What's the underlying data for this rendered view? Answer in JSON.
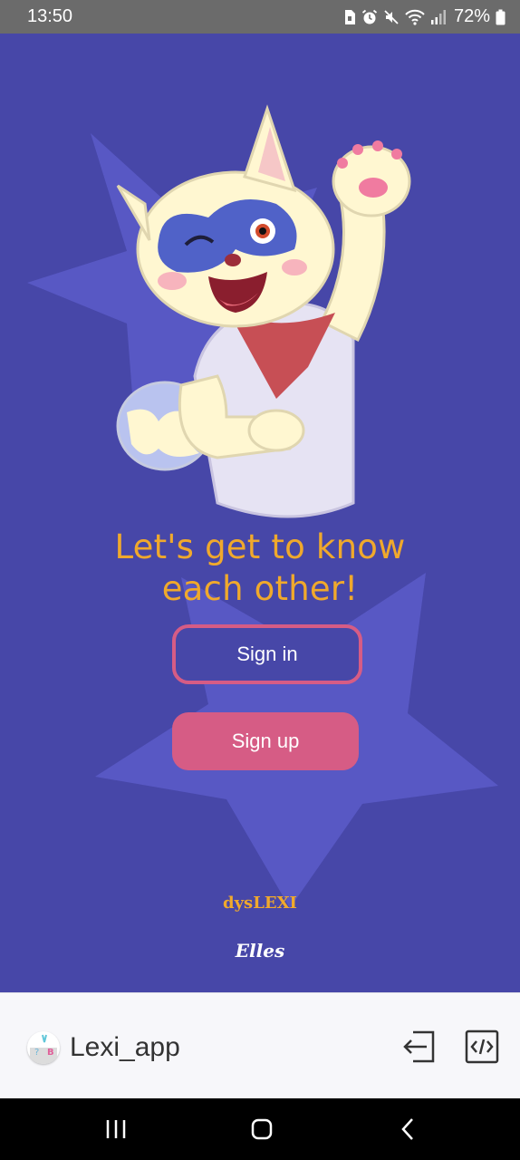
{
  "status_bar": {
    "time": "13:50",
    "battery": "72%",
    "icons": [
      "sim-icon",
      "alarm-icon",
      "mute-icon",
      "wifi-icon",
      "signal-icon",
      "battery-icon"
    ]
  },
  "screen": {
    "background": "#4747a8",
    "mascot": "raccoon-mascot-waving",
    "headline_line1": "Let's get to know",
    "headline_line2": "each other!",
    "sign_in_label": "Sign in",
    "sign_up_label": "Sign up",
    "brand": "dysLEXI",
    "signature": "Elles",
    "accent": "#f0a92c",
    "button_color": "#d65c85"
  },
  "bottom_bar": {
    "app_name": "Lexi_app",
    "logo_icon": "lexi-app-logo",
    "exit_icon": "exit-icon",
    "code_icon": "code-icon"
  },
  "nav_bar": {
    "buttons": [
      "recent-apps-icon",
      "home-icon",
      "back-icon"
    ]
  }
}
